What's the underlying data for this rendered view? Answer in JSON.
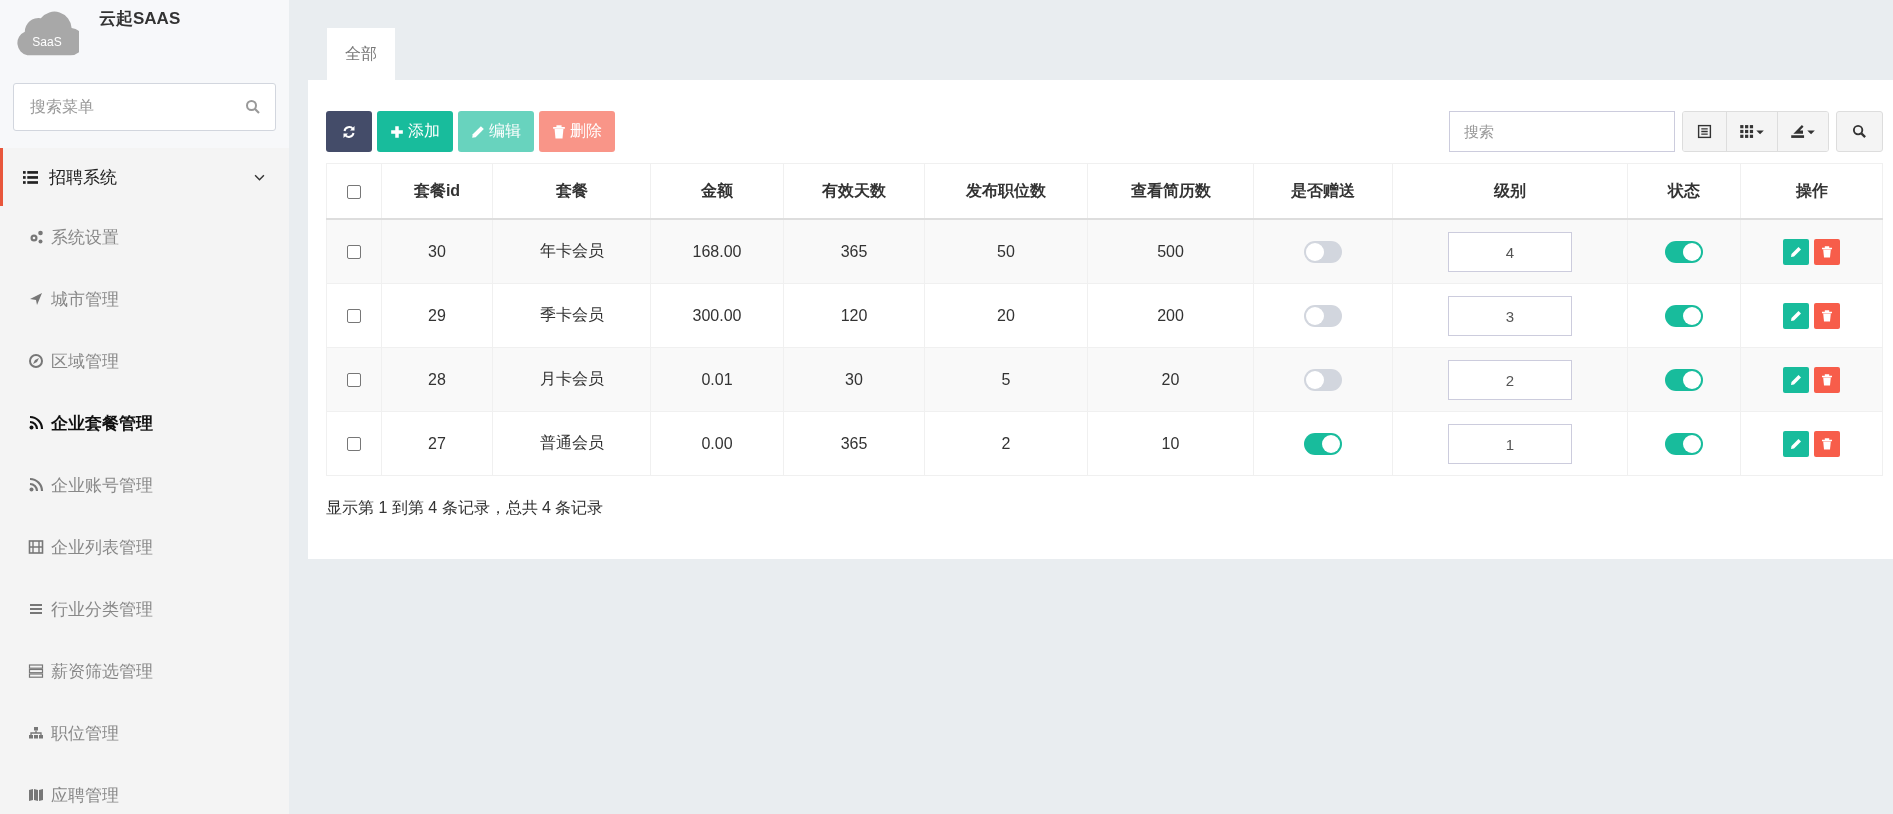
{
  "sidebar": {
    "logo_text": "SaaS",
    "app_name": "云起SAAS",
    "search": {
      "placeholder": "搜索菜单"
    },
    "group": {
      "label": "招聘系统",
      "expanded": true,
      "items": [
        {
          "label": "系统设置",
          "selected": false
        },
        {
          "label": "城市管理",
          "selected": false
        },
        {
          "label": "区域管理",
          "selected": false
        },
        {
          "label": "企业套餐管理",
          "selected": true
        },
        {
          "label": "企业账号管理",
          "selected": false
        },
        {
          "label": "企业列表管理",
          "selected": false
        },
        {
          "label": "行业分类管理",
          "selected": false
        },
        {
          "label": "薪资筛选管理",
          "selected": false
        },
        {
          "label": "职位管理",
          "selected": false
        },
        {
          "label": "应聘管理",
          "selected": false
        }
      ]
    }
  },
  "tabs": [
    {
      "label": "全部",
      "selected": true
    }
  ],
  "toolbar": {
    "buttons": [
      {
        "kind": "refresh",
        "disabled": false
      },
      {
        "kind": "add",
        "label": "添加",
        "disabled": false
      },
      {
        "kind": "edit",
        "label": "编辑",
        "disabled": true
      },
      {
        "kind": "delete",
        "label": "删除",
        "disabled": true
      }
    ],
    "search": {
      "placeholder": "搜索"
    }
  },
  "table": {
    "all_checked": false,
    "columns": [
      "套餐id",
      "套餐",
      "金额",
      "有效天数",
      "发布职位数",
      "查看简历数",
      "是否赠送",
      "级别",
      "状态",
      "操作"
    ],
    "rows": [
      {
        "checked": false,
        "id": "30",
        "name": "年卡会员",
        "amount": "168.00",
        "days": "365",
        "posts": "50",
        "resumes": "500",
        "gift": false,
        "level": "4",
        "status": true
      },
      {
        "checked": false,
        "id": "29",
        "name": "季卡会员",
        "amount": "300.00",
        "days": "120",
        "posts": "20",
        "resumes": "200",
        "gift": false,
        "level": "3",
        "status": true
      },
      {
        "checked": false,
        "id": "28",
        "name": "月卡会员",
        "amount": "0.01",
        "days": "30",
        "posts": "5",
        "resumes": "20",
        "gift": false,
        "level": "2",
        "status": true
      },
      {
        "checked": false,
        "id": "27",
        "name": "普通会员",
        "amount": "0.00",
        "days": "365",
        "posts": "2",
        "resumes": "10",
        "gift": true,
        "level": "1",
        "status": true
      }
    ]
  },
  "pagination_info": "显示第 1 到第 4 条记录，总共 4 条记录"
}
